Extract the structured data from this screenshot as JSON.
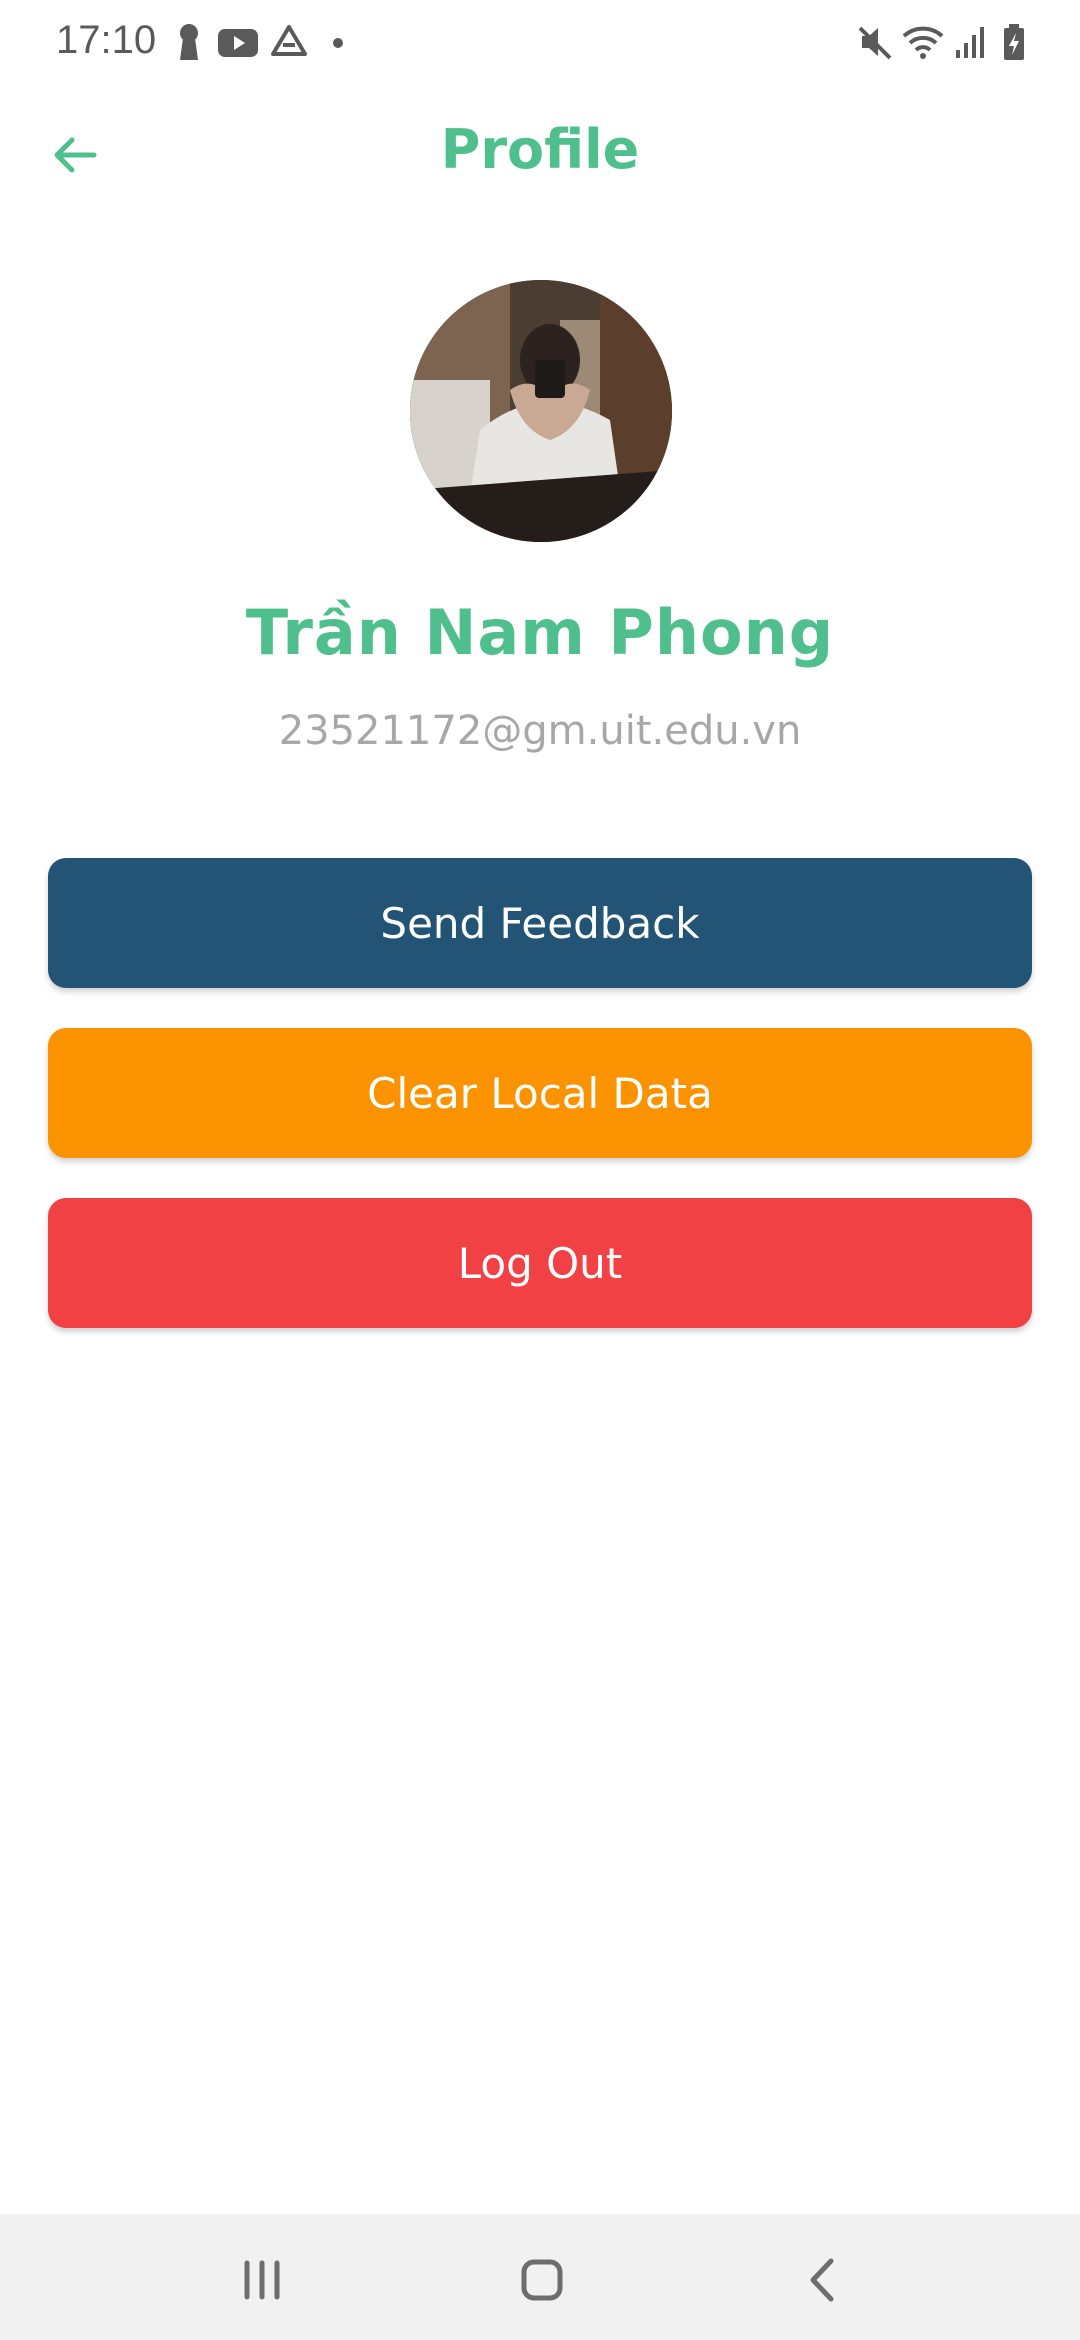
{
  "status_bar": {
    "time": "17:10",
    "icons": [
      "keyhole-icon",
      "youtube-icon",
      "drive-icon",
      "dot-icon",
      "mute-icon",
      "wifi-icon",
      "signal-icon",
      "battery-icon"
    ]
  },
  "header": {
    "title": "Profile",
    "back_icon": "arrow-left-icon"
  },
  "profile": {
    "name": "Trần Nam Phong",
    "email": "23521172@gm.uit.edu.vn"
  },
  "actions": {
    "send_feedback": "Send Feedback",
    "clear_local_data": "Clear Local Data",
    "log_out": "Log Out"
  },
  "colors": {
    "accent": "#4fc08d",
    "feedback": "#235475",
    "clear": "#fb9300",
    "logout": "#f24144"
  },
  "nav_bar": {
    "icons": [
      "recent-apps-icon",
      "home-icon",
      "back-icon"
    ]
  }
}
